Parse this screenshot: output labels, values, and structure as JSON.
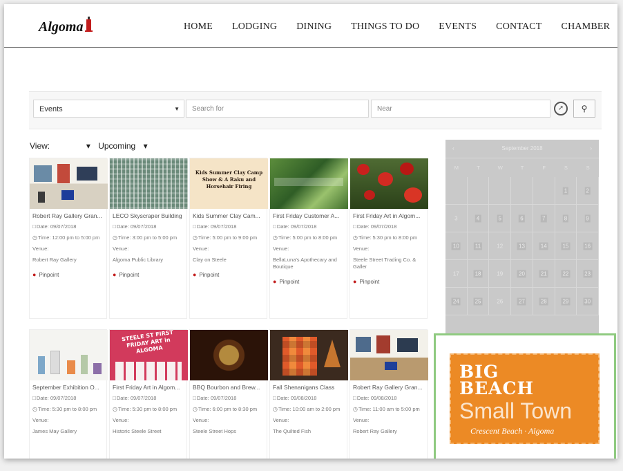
{
  "logo": {
    "text": "Algoma"
  },
  "nav": [
    "HOME",
    "LODGING",
    "DINING",
    "THINGS TO DO",
    "EVENTS",
    "CONTACT",
    "CHAMBER"
  ],
  "search": {
    "type_value": "Events",
    "search_placeholder": "Search for",
    "near_placeholder": "Near",
    "button_icon": "search-icon",
    "location_icon": "compass-icon"
  },
  "view": {
    "label": "View:",
    "mode": "Upcoming"
  },
  "events": [
    {
      "title": "Robert Ray Gallery Gran...",
      "date": "Date: 09/07/2018",
      "time": "Time: 12:00 pm to 5:00 pm",
      "venue_label": "Venue:",
      "venue": "Robert Ray Gallery",
      "pin": "Pinpoint"
    },
    {
      "title": "LECO Skyscraper Building",
      "date": "Date: 09/07/2018",
      "time": "Time: 3:00 pm to 5:00 pm",
      "venue_label": "Venue:",
      "venue": "Algoma Public Library",
      "pin": "Pinpoint"
    },
    {
      "title": "Kids Summer Clay Cam...",
      "date": "Date: 09/07/2018",
      "time": "Time: 5:00 pm to 9:00 pm",
      "venue_label": "Venue:",
      "venue": "Clay on Steele",
      "pin": "Pinpoint",
      "image_text": "Kids Summer Clay Camp Show & A Raku and Horsehair Firing"
    },
    {
      "title": "First Friday Customer A...",
      "date": "Date: 09/07/2018",
      "time": "Time: 5:00 pm to 8:00 pm",
      "venue_label": "Venue:",
      "venue": "BellaLuna's Apothecary and Boutique",
      "pin": "Pinpoint"
    },
    {
      "title": "First Friday Art in Algom...",
      "date": "Date: 09/07/2018",
      "time": "Time: 5:30 pm to 8:00 pm",
      "venue_label": "Venue:",
      "venue": "Steele Street Trading Co. & Galler",
      "pin": "Pinpoint"
    },
    {
      "title": "September Exhibition O...",
      "date": "Date: 09/07/2018",
      "time": "Time: 5:30 pm to 8:00 pm",
      "venue_label": "Venue:",
      "venue": "James May Gallery",
      "pin": "Pinpoint"
    },
    {
      "title": "First Friday Art in Algom...",
      "date": "Date: 09/07/2018",
      "time": "Time: 5:30 pm to 8:00 pm",
      "venue_label": "Venue:",
      "venue": "Historic Steele Street",
      "pin": "Pinpoint",
      "image_text": "STEELE ST FIRST FRIDAY ART in ALGOMA"
    },
    {
      "title": "BBQ Bourbon and Brew...",
      "date": "Date: 09/07/2018",
      "time": "Time: 6:00 pm to 8:30 pm",
      "venue_label": "Venue:",
      "venue": "Steele Street Hops",
      "pin": "Pinpoint"
    },
    {
      "title": "Fall Shenanigans Class",
      "date": "Date: 09/08/2018",
      "time": "Time: 10:00 am to 2:00 pm",
      "venue_label": "Venue:",
      "venue": "The Quilted Fish",
      "pin": "Pinpoint"
    },
    {
      "title": "Robert Ray Gallery Gran...",
      "date": "Date: 09/08/2018",
      "time": "Time: 11:00 am to 5:00 pm",
      "venue_label": "Venue:",
      "venue": "Robert Ray Gallery",
      "pin": "Pinpoint"
    }
  ],
  "calendar": {
    "month": "September 2018",
    "prev": "‹",
    "next": "›",
    "weekdays": [
      "M",
      "T",
      "W",
      "T",
      "F",
      "S",
      "S"
    ],
    "cells": [
      "",
      "",
      "",
      "",
      "",
      "1",
      "2",
      "3",
      "4",
      "5",
      "6",
      "7",
      "8",
      "9",
      "10",
      "11",
      "12",
      "13",
      "14",
      "15",
      "16",
      "17",
      "18",
      "19",
      "20",
      "21",
      "22",
      "23",
      "24",
      "25",
      "26",
      "27",
      "28",
      "29",
      "30"
    ],
    "highlighted": [
      "1",
      "2",
      "4",
      "5",
      "6",
      "7",
      "8",
      "9",
      "10",
      "11",
      "13",
      "14",
      "15",
      "16",
      "18",
      "20",
      "21",
      "22",
      "23",
      "24",
      "25",
      "27",
      "28",
      "29",
      "30"
    ]
  },
  "promo": {
    "line1": "BIG",
    "line2": "BEACH",
    "line3": "Small Town",
    "line4": "Crescent Beach · Algoma"
  },
  "colors": {
    "accent_red": "#c21d1d",
    "promo_orange": "#ec8a25",
    "promo_border": "#8fca80",
    "calendar_bg": "#c9c9c9"
  }
}
